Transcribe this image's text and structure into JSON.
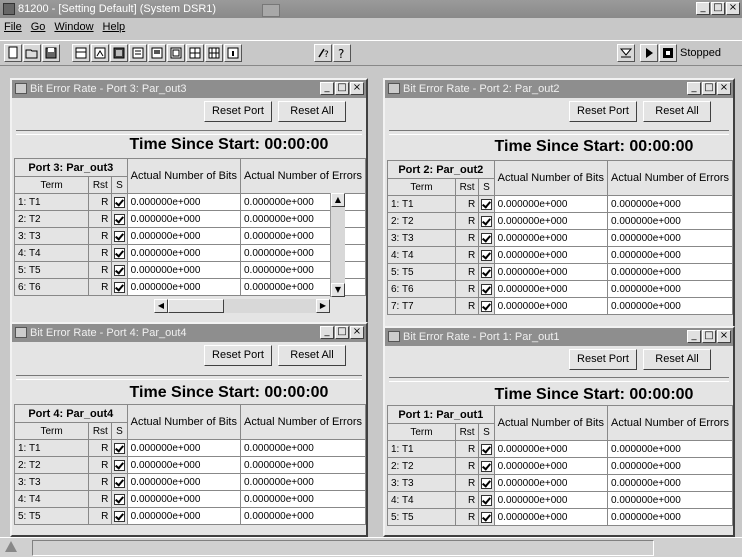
{
  "app": {
    "title": "81200 - [Setting Default] (System DSR1)"
  },
  "menu": [
    "File",
    "Go",
    "Window",
    "Help"
  ],
  "toolbar": {
    "status": "Stopped"
  },
  "windows": [
    {
      "title": "Bit Error Rate - Port 3: Par_out3",
      "reset_port": "Reset Port",
      "reset_all": "Reset All",
      "time_label": "Time Since Start:",
      "time": "00:00:00",
      "port_label": "Port 3: Par_out3",
      "col_term": "Term",
      "col_rst": "Rst",
      "col_s": "S",
      "col_bits": "Actual Number of Bits",
      "col_errors": "Actual Number of Errors",
      "rows": [
        {
          "term": "1: T1",
          "rst": "R",
          "bits": "0.000000e+000",
          "errors": "0.000000e+000"
        },
        {
          "term": "2: T2",
          "rst": "R",
          "bits": "0.000000e+000",
          "errors": "0.000000e+000"
        },
        {
          "term": "3: T3",
          "rst": "R",
          "bits": "0.000000e+000",
          "errors": "0.000000e+000"
        },
        {
          "term": "4: T4",
          "rst": "R",
          "bits": "0.000000e+000",
          "errors": "0.000000e+000"
        },
        {
          "term": "5: T5",
          "rst": "R",
          "bits": "0.000000e+000",
          "errors": "0.000000e+000"
        },
        {
          "term": "6: T6",
          "rst": "R",
          "bits": "0.000000e+000",
          "errors": "0.000000e+000"
        }
      ]
    },
    {
      "title": "Bit Error Rate - Port 2: Par_out2",
      "reset_port": "Reset Port",
      "reset_all": "Reset All",
      "time_label": "Time Since Start:",
      "time": "00:00:00",
      "port_label": "Port 2: Par_out2",
      "col_term": "Term",
      "col_rst": "Rst",
      "col_s": "S",
      "col_bits": "Actual Number of Bits",
      "col_errors": "Actual Number of Errors",
      "rows": [
        {
          "term": "1: T1",
          "rst": "R",
          "bits": "0.000000e+000",
          "errors": "0.000000e+000"
        },
        {
          "term": "2: T2",
          "rst": "R",
          "bits": "0.000000e+000",
          "errors": "0.000000e+000"
        },
        {
          "term": "3: T3",
          "rst": "R",
          "bits": "0.000000e+000",
          "errors": "0.000000e+000"
        },
        {
          "term": "4: T4",
          "rst": "R",
          "bits": "0.000000e+000",
          "errors": "0.000000e+000"
        },
        {
          "term": "5: T5",
          "rst": "R",
          "bits": "0.000000e+000",
          "errors": "0.000000e+000"
        },
        {
          "term": "6: T6",
          "rst": "R",
          "bits": "0.000000e+000",
          "errors": "0.000000e+000"
        },
        {
          "term": "7: T7",
          "rst": "R",
          "bits": "0.000000e+000",
          "errors": "0.000000e+000"
        }
      ]
    },
    {
      "title": "Bit Error Rate - Port 4: Par_out4",
      "reset_port": "Reset Port",
      "reset_all": "Reset All",
      "time_label": "Time Since Start:",
      "time": "00:00:00",
      "port_label": "Port 4: Par_out4",
      "col_term": "Term",
      "col_rst": "Rst",
      "col_s": "S",
      "col_bits": "Actual Number of Bits",
      "col_errors": "Actual Number of Errors",
      "rows": [
        {
          "term": "1: T1",
          "rst": "R",
          "bits": "0.000000e+000",
          "errors": "0.000000e+000"
        },
        {
          "term": "2: T2",
          "rst": "R",
          "bits": "0.000000e+000",
          "errors": "0.000000e+000"
        },
        {
          "term": "3: T3",
          "rst": "R",
          "bits": "0.000000e+000",
          "errors": "0.000000e+000"
        },
        {
          "term": "4: T4",
          "rst": "R",
          "bits": "0.000000e+000",
          "errors": "0.000000e+000"
        },
        {
          "term": "5: T5",
          "rst": "R",
          "bits": "0.000000e+000",
          "errors": "0.000000e+000"
        }
      ]
    },
    {
      "title": "Bit Error Rate - Port 1: Par_out1",
      "reset_port": "Reset Port",
      "reset_all": "Reset All",
      "time_label": "Time Since Start:",
      "time": "00:00:00",
      "port_label": "Port 1: Par_out1",
      "col_term": "Term",
      "col_rst": "Rst",
      "col_s": "S",
      "col_bits": "Actual Number of Bits",
      "col_errors": "Actual Number of Errors",
      "rows": [
        {
          "term": "1: T1",
          "rst": "R",
          "bits": "0.000000e+000",
          "errors": "0.000000e+000"
        },
        {
          "term": "2: T2",
          "rst": "R",
          "bits": "0.000000e+000",
          "errors": "0.000000e+000"
        },
        {
          "term": "3: T3",
          "rst": "R",
          "bits": "0.000000e+000",
          "errors": "0.000000e+000"
        },
        {
          "term": "4: T4",
          "rst": "R",
          "bits": "0.000000e+000",
          "errors": "0.000000e+000"
        },
        {
          "term": "5: T5",
          "rst": "R",
          "bits": "0.000000e+000",
          "errors": "0.000000e+000"
        }
      ]
    }
  ]
}
